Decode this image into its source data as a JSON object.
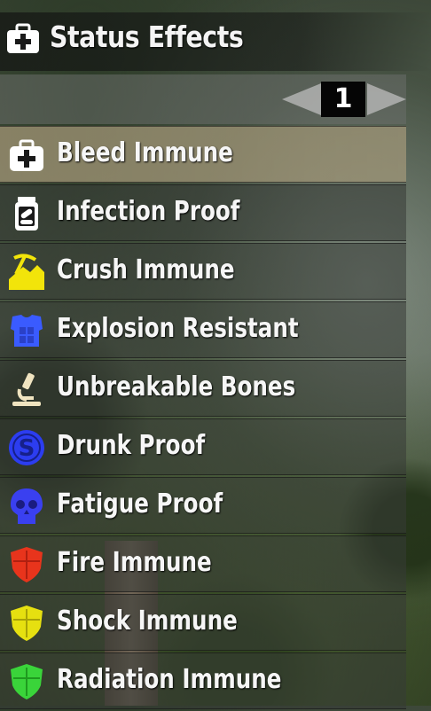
{
  "header": {
    "title": "Status Effects",
    "icon": "medkit-icon"
  },
  "pager": {
    "page": "1"
  },
  "effects": [
    {
      "label": "Bleed Immune",
      "icon": "medkit-icon",
      "color": "#ffffff"
    },
    {
      "label": "Infection Proof",
      "icon": "pill-bottle-icon",
      "color": "#ffffff"
    },
    {
      "label": "Crush Immune",
      "icon": "pickaxe-rock-icon",
      "color": "#f2e40a"
    },
    {
      "label": "Explosion Resistant",
      "icon": "armor-vest-icon",
      "color": "#3a5bff"
    },
    {
      "label": "Unbreakable Bones",
      "icon": "microscope-icon",
      "color": "#f0e4c0"
    },
    {
      "label": "Drunk Proof",
      "icon": "coin-icon",
      "color": "#2c3df0"
    },
    {
      "label": "Fatigue Proof",
      "icon": "skull-icon",
      "color": "#3a40f0"
    },
    {
      "label": "Fire Immune",
      "icon": "shield-icon",
      "color": "#e8341c"
    },
    {
      "label": "Shock Immune",
      "icon": "shield-icon",
      "color": "#e6e010"
    },
    {
      "label": "Radiation Immune",
      "icon": "shield-icon",
      "color": "#3ad43a"
    }
  ]
}
